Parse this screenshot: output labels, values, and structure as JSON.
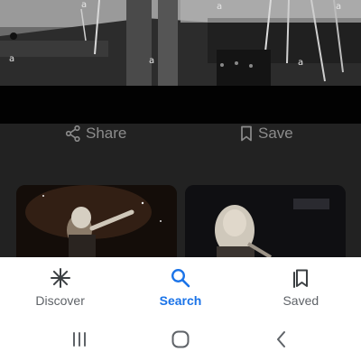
{
  "actions": {
    "share_label": "Share",
    "save_label": "Save"
  },
  "bottom_nav": {
    "items": [
      {
        "label": "Discover",
        "icon": "asterisk-icon",
        "active": false
      },
      {
        "label": "Search",
        "icon": "search-icon",
        "active": true
      },
      {
        "label": "Saved",
        "icon": "bookmarks-icon",
        "active": false
      }
    ]
  },
  "system_nav": {
    "buttons": [
      "recents-icon",
      "home-icon",
      "back-icon"
    ]
  },
  "colors": {
    "active_nav": "#1a73e8",
    "inactive_nav": "#5f6368",
    "scrim": "#222222"
  }
}
